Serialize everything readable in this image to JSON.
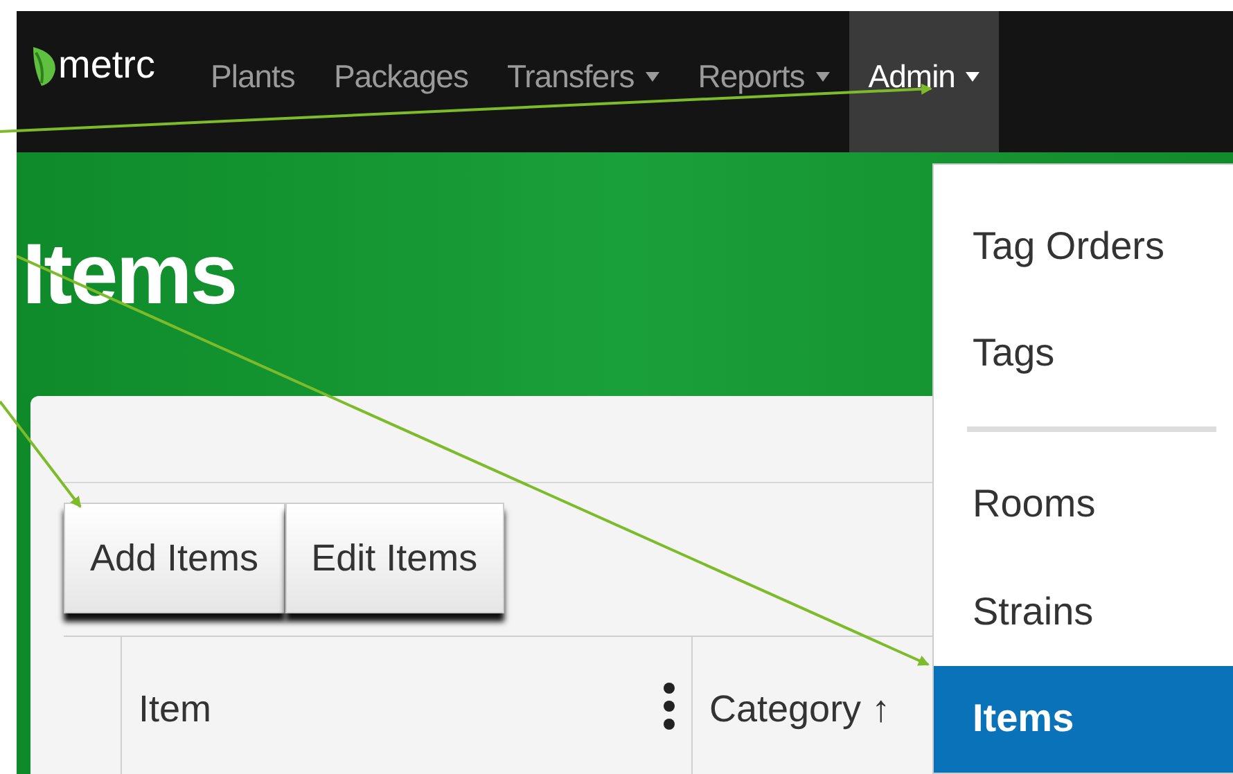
{
  "navbar": {
    "logo": "metrc",
    "items": [
      {
        "label": "Plants",
        "dropdown": false,
        "selected": false
      },
      {
        "label": "Packages",
        "dropdown": false,
        "selected": false
      },
      {
        "label": "Transfers",
        "dropdown": true,
        "selected": false
      },
      {
        "label": "Reports",
        "dropdown": true,
        "selected": false
      },
      {
        "label": "Admin",
        "dropdown": true,
        "selected": true
      }
    ]
  },
  "page": {
    "title": "Items"
  },
  "toolbar": {
    "buttons": [
      "Add Items",
      "Edit Items"
    ]
  },
  "table": {
    "columns": [
      {
        "label": "Item",
        "menu": true
      },
      {
        "label": "Category",
        "menu": false,
        "sort": "↑"
      }
    ]
  },
  "dropdown_menu": {
    "items": [
      {
        "kind": "item",
        "label": "Tag Orders",
        "selected": false
      },
      {
        "kind": "item",
        "label": "Tags",
        "selected": false
      },
      {
        "kind": "divider"
      },
      {
        "kind": "item",
        "label": "Rooms",
        "selected": false
      },
      {
        "kind": "item",
        "label": "Strains",
        "selected": false
      },
      {
        "kind": "item",
        "label": "Items",
        "selected": true
      }
    ]
  }
}
